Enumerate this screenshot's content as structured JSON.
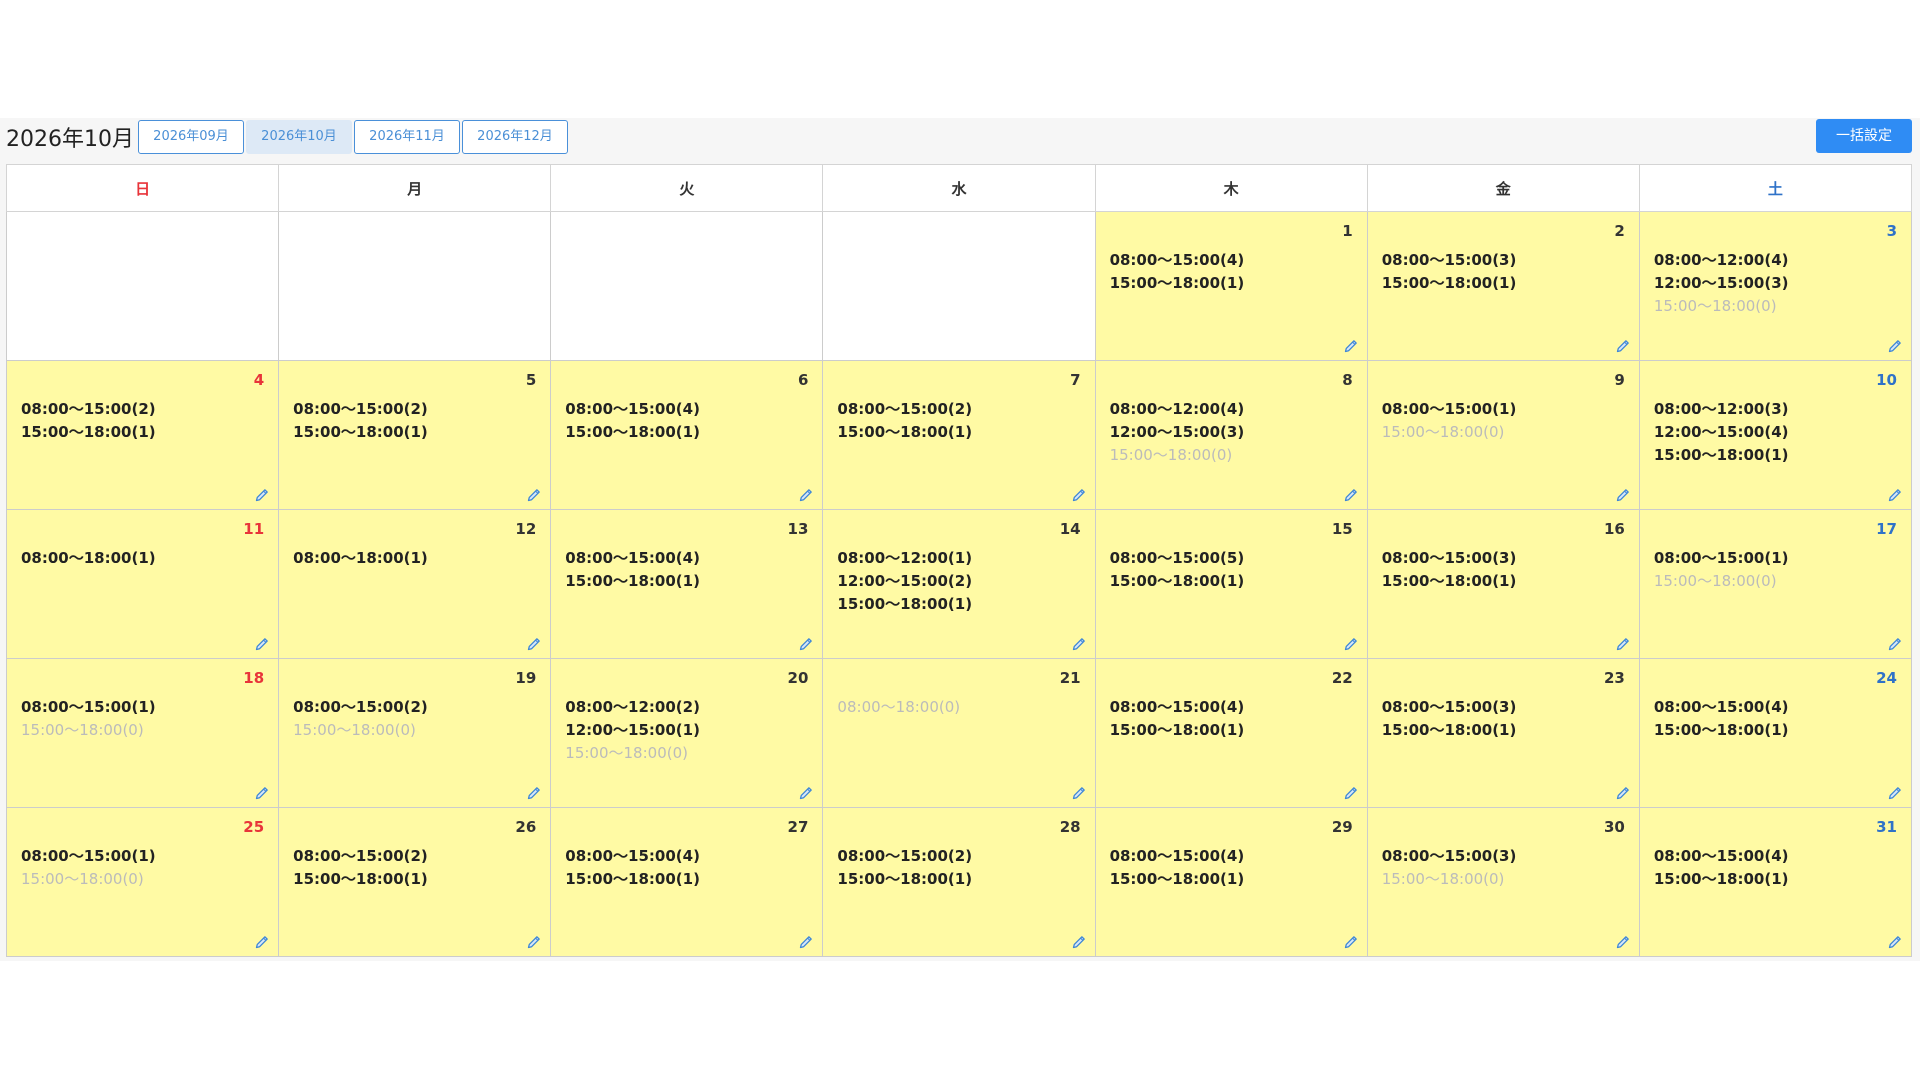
{
  "header": {
    "title": "2026年10月",
    "month_buttons": [
      "2026年09月",
      "2026年10月",
      "2026年11月",
      "2026年12月"
    ],
    "active_month_index": 1,
    "bulk_button": "一括設定"
  },
  "weekdays": [
    "日",
    "月",
    "火",
    "水",
    "木",
    "金",
    "土"
  ],
  "colors": {
    "filled_cell": "#fffaa4",
    "sunday": "#e8343a",
    "saturday": "#2f72c8",
    "accent": "#2f8cf4",
    "zero_slot": "#bbbbbb"
  },
  "icons": {
    "edit": "pencil-icon"
  },
  "days": [
    {
      "day": 1,
      "slots": [
        {
          "text": "08:00〜15:00(4)",
          "zero": false
        },
        {
          "text": "15:00〜18:00(1)",
          "zero": false
        }
      ]
    },
    {
      "day": 2,
      "slots": [
        {
          "text": "08:00〜15:00(3)",
          "zero": false
        },
        {
          "text": "15:00〜18:00(1)",
          "zero": false
        }
      ]
    },
    {
      "day": 3,
      "slots": [
        {
          "text": "08:00〜12:00(4)",
          "zero": false
        },
        {
          "text": "12:00〜15:00(3)",
          "zero": false
        },
        {
          "text": "15:00〜18:00(0)",
          "zero": true
        }
      ]
    },
    {
      "day": 4,
      "slots": [
        {
          "text": "08:00〜15:00(2)",
          "zero": false
        },
        {
          "text": "15:00〜18:00(1)",
          "zero": false
        }
      ]
    },
    {
      "day": 5,
      "slots": [
        {
          "text": "08:00〜15:00(2)",
          "zero": false
        },
        {
          "text": "15:00〜18:00(1)",
          "zero": false
        }
      ]
    },
    {
      "day": 6,
      "slots": [
        {
          "text": "08:00〜15:00(4)",
          "zero": false
        },
        {
          "text": "15:00〜18:00(1)",
          "zero": false
        }
      ]
    },
    {
      "day": 7,
      "slots": [
        {
          "text": "08:00〜15:00(2)",
          "zero": false
        },
        {
          "text": "15:00〜18:00(1)",
          "zero": false
        }
      ]
    },
    {
      "day": 8,
      "slots": [
        {
          "text": "08:00〜12:00(4)",
          "zero": false
        },
        {
          "text": "12:00〜15:00(3)",
          "zero": false
        },
        {
          "text": "15:00〜18:00(0)",
          "zero": true
        }
      ]
    },
    {
      "day": 9,
      "slots": [
        {
          "text": "08:00〜15:00(1)",
          "zero": false
        },
        {
          "text": "15:00〜18:00(0)",
          "zero": true
        }
      ]
    },
    {
      "day": 10,
      "slots": [
        {
          "text": "08:00〜12:00(3)",
          "zero": false
        },
        {
          "text": "12:00〜15:00(4)",
          "zero": false
        },
        {
          "text": "15:00〜18:00(1)",
          "zero": false
        }
      ]
    },
    {
      "day": 11,
      "slots": [
        {
          "text": "08:00〜18:00(1)",
          "zero": false
        }
      ]
    },
    {
      "day": 12,
      "slots": [
        {
          "text": "08:00〜18:00(1)",
          "zero": false
        }
      ]
    },
    {
      "day": 13,
      "slots": [
        {
          "text": "08:00〜15:00(4)",
          "zero": false
        },
        {
          "text": "15:00〜18:00(1)",
          "zero": false
        }
      ]
    },
    {
      "day": 14,
      "slots": [
        {
          "text": "08:00〜12:00(1)",
          "zero": false
        },
        {
          "text": "12:00〜15:00(2)",
          "zero": false
        },
        {
          "text": "15:00〜18:00(1)",
          "zero": false
        }
      ]
    },
    {
      "day": 15,
      "slots": [
        {
          "text": "08:00〜15:00(5)",
          "zero": false
        },
        {
          "text": "15:00〜18:00(1)",
          "zero": false
        }
      ]
    },
    {
      "day": 16,
      "slots": [
        {
          "text": "08:00〜15:00(3)",
          "zero": false
        },
        {
          "text": "15:00〜18:00(1)",
          "zero": false
        }
      ]
    },
    {
      "day": 17,
      "slots": [
        {
          "text": "08:00〜15:00(1)",
          "zero": false
        },
        {
          "text": "15:00〜18:00(0)",
          "zero": true
        }
      ]
    },
    {
      "day": 18,
      "slots": [
        {
          "text": "08:00〜15:00(1)",
          "zero": false
        },
        {
          "text": "15:00〜18:00(0)",
          "zero": true
        }
      ]
    },
    {
      "day": 19,
      "slots": [
        {
          "text": "08:00〜15:00(2)",
          "zero": false
        },
        {
          "text": "15:00〜18:00(0)",
          "zero": true
        }
      ]
    },
    {
      "day": 20,
      "slots": [
        {
          "text": "08:00〜12:00(2)",
          "zero": false
        },
        {
          "text": "12:00〜15:00(1)",
          "zero": false
        },
        {
          "text": "15:00〜18:00(0)",
          "zero": true
        }
      ]
    },
    {
      "day": 21,
      "slots": [
        {
          "text": "08:00〜18:00(0)",
          "zero": true
        }
      ]
    },
    {
      "day": 22,
      "slots": [
        {
          "text": "08:00〜15:00(4)",
          "zero": false
        },
        {
          "text": "15:00〜18:00(1)",
          "zero": false
        }
      ]
    },
    {
      "day": 23,
      "slots": [
        {
          "text": "08:00〜15:00(3)",
          "zero": false
        },
        {
          "text": "15:00〜18:00(1)",
          "zero": false
        }
      ]
    },
    {
      "day": 24,
      "slots": [
        {
          "text": "08:00〜15:00(4)",
          "zero": false
        },
        {
          "text": "15:00〜18:00(1)",
          "zero": false
        }
      ]
    },
    {
      "day": 25,
      "slots": [
        {
          "text": "08:00〜15:00(1)",
          "zero": false
        },
        {
          "text": "15:00〜18:00(0)",
          "zero": true
        }
      ]
    },
    {
      "day": 26,
      "slots": [
        {
          "text": "08:00〜15:00(2)",
          "zero": false
        },
        {
          "text": "15:00〜18:00(1)",
          "zero": false
        }
      ]
    },
    {
      "day": 27,
      "slots": [
        {
          "text": "08:00〜15:00(4)",
          "zero": false
        },
        {
          "text": "15:00〜18:00(1)",
          "zero": false
        }
      ]
    },
    {
      "day": 28,
      "slots": [
        {
          "text": "08:00〜15:00(2)",
          "zero": false
        },
        {
          "text": "15:00〜18:00(1)",
          "zero": false
        }
      ]
    },
    {
      "day": 29,
      "slots": [
        {
          "text": "08:00〜15:00(4)",
          "zero": false
        },
        {
          "text": "15:00〜18:00(1)",
          "zero": false
        }
      ]
    },
    {
      "day": 30,
      "slots": [
        {
          "text": "08:00〜15:00(3)",
          "zero": false
        },
        {
          "text": "15:00〜18:00(0)",
          "zero": true
        }
      ]
    },
    {
      "day": 31,
      "slots": [
        {
          "text": "08:00〜15:00(4)",
          "zero": false
        },
        {
          "text": "15:00〜18:00(1)",
          "zero": false
        }
      ]
    }
  ]
}
